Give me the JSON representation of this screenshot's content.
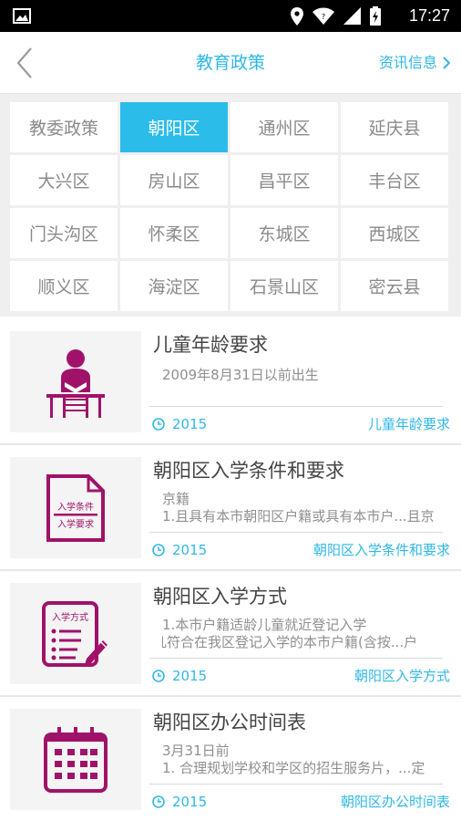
{
  "status_bar": {
    "time": "17:27"
  },
  "header": {
    "title": "教育政策",
    "right_link": "资讯信息"
  },
  "districts": [
    "教委政策",
    "朝阳区",
    "通州区",
    "延庆县",
    "大兴区",
    "房山区",
    "昌平区",
    "丰台区",
    "门头沟区",
    "怀柔区",
    "东城区",
    "西城区",
    "顺义区",
    "海淀区",
    "石景山区",
    "密云县"
  ],
  "selected_district": "朝阳区",
  "items": [
    {
      "title": "儿童年龄要求",
      "desc_lines": [
        "2009年8月31日以前出生"
      ],
      "year": "2015",
      "tag": "儿童年龄要求",
      "icon": "student-desk-icon"
    },
    {
      "title": "朝阳区入学条件和要求",
      "desc_lines": [
        "京籍",
        "1.且具有本市朝阳区户籍或具有本市户...且京"
      ],
      "year": "2015",
      "tag": "朝阳区入学条件和要求",
      "icon": "document-icon",
      "icon_labels": [
        "入学条件",
        "入学要求"
      ]
    },
    {
      "title": "朝阳区入学方式",
      "desc_lines": [
        "1.本市户籍适龄儿童就近登记入学",
        "凡符合在我区登记入学的本市户籍(含按...户"
      ],
      "year": "2015",
      "tag": "朝阳区入学方式",
      "icon": "checklist-icon",
      "icon_labels": [
        "入学方式"
      ]
    },
    {
      "title": "朝阳区办公时间表",
      "desc_lines": [
        "3月31日前",
        "1. 合理规划学校和学区的招生服务片，...定"
      ],
      "year": "2015",
      "tag": "朝阳区办公时间表",
      "icon": "calendar-icon"
    }
  ],
  "colors": {
    "accent": "#2fb8e6",
    "icon": "#a0126a",
    "active_cell": "#2bbcea"
  }
}
